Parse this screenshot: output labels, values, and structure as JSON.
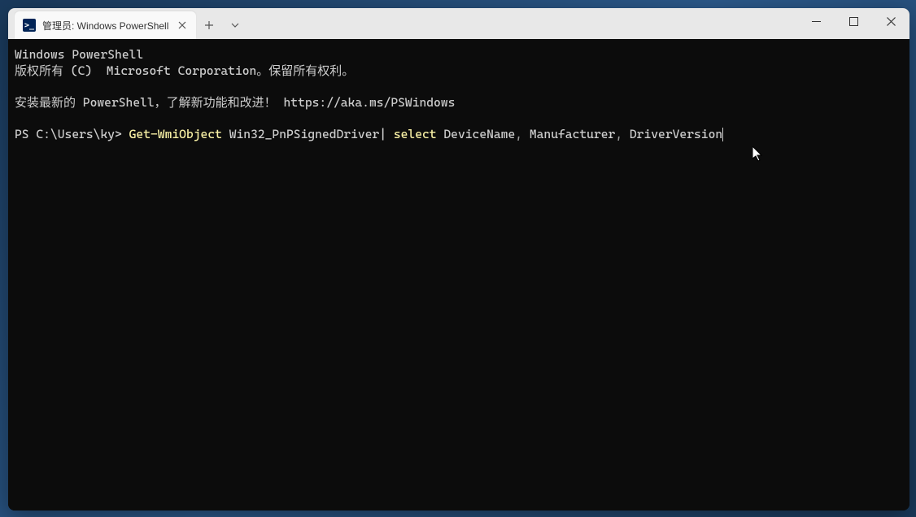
{
  "tab": {
    "icon_glyph": ">_",
    "title": "管理员: Windows PowerShell"
  },
  "terminal": {
    "header1": "Windows PowerShell",
    "header2": "版权所有 (C)  Microsoft Corporation。保留所有权利。",
    "install_msg_prefix": "安装最新的 PowerShell，了解新功能和改进！",
    "install_url": "https://aka.ms/PSWindows",
    "prompt": "PS C:\\Users\\ky>",
    "cmd_part1": "Get-WmiObject",
    "cmd_part2": " Win32_PnPSignedDriver",
    "cmd_pipe": "| ",
    "cmd_part3": "select",
    "cmd_part4": " DeviceName",
    "cmd_comma1": ", ",
    "cmd_part5": "Manufacturer",
    "cmd_comma2": ", ",
    "cmd_part6": "DriverVersion"
  }
}
